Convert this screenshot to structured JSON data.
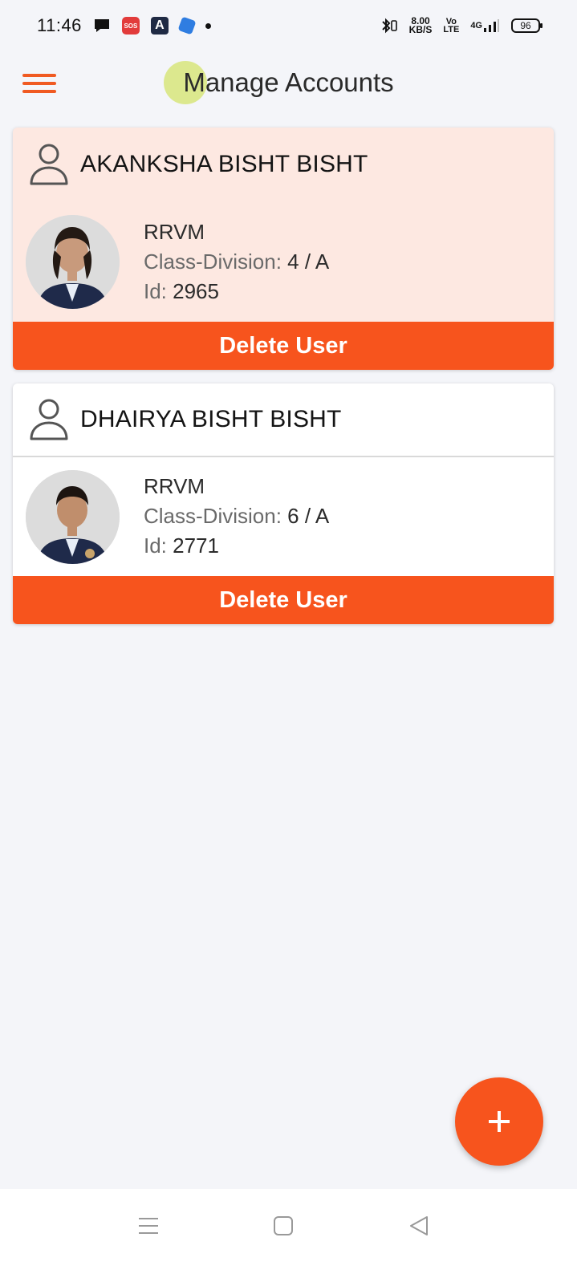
{
  "status_bar": {
    "time": "11:46",
    "sos_label": "SOS",
    "app_letter": "A",
    "speed_value": "8.00",
    "speed_unit": "KB/S",
    "volte_top": "Vo",
    "volte_bottom": "LTE",
    "network": "4G",
    "battery": "96"
  },
  "header": {
    "title": "Manage Accounts"
  },
  "accounts": [
    {
      "name": "AKANKSHA BISHT BISHT",
      "school": "RRVM",
      "class_label": "Class-Division: ",
      "class_value": "4 / A",
      "id_label": "Id: ",
      "id_value": "2965",
      "delete_label": "Delete User"
    },
    {
      "name": "DHAIRYA BISHT BISHT",
      "school": "RRVM",
      "class_label": "Class-Division: ",
      "class_value": "6 / A",
      "id_label": "Id: ",
      "id_value": "2771",
      "delete_label": "Delete User"
    }
  ],
  "fab": {
    "icon": "plus-icon"
  },
  "colors": {
    "accent": "#f7541d",
    "selected_card": "#fde8e1",
    "background": "#f4f5f9"
  }
}
